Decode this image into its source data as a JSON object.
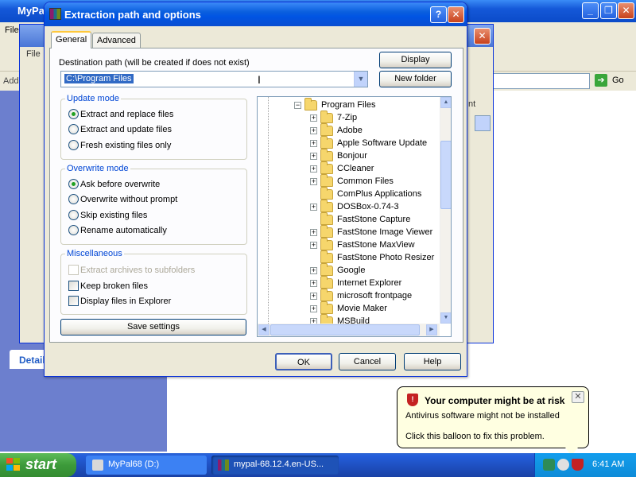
{
  "background": {
    "window_title": "MyPal68 (D:)",
    "menu_file": "File",
    "address_label": "Address",
    "go_label": "Go",
    "details_label": "Details"
  },
  "rar_window": {
    "title": "mypal-68.12.4.en-US...",
    "menu_file": "File",
    "right_label": "nt"
  },
  "dialog": {
    "title": "Extraction path and options",
    "tabs": [
      "General",
      "Advanced"
    ],
    "dest_label": "Destination path (will be created if does not exist)",
    "dest_value": "C:\\Program Files",
    "display_button": "Display",
    "new_folder_button": "New folder",
    "update_mode": {
      "title": "Update mode",
      "options": [
        "Extract and replace files",
        "Extract and update files",
        "Fresh existing files only"
      ],
      "selected": 0
    },
    "overwrite_mode": {
      "title": "Overwrite mode",
      "options": [
        "Ask before overwrite",
        "Overwrite without prompt",
        "Skip existing files",
        "Rename automatically"
      ],
      "selected": 0
    },
    "misc": {
      "title": "Miscellaneous",
      "options": [
        {
          "label": "Extract archives to subfolders",
          "checked": false,
          "disabled": true
        },
        {
          "label": "Keep broken files",
          "checked": false,
          "disabled": false
        },
        {
          "label": "Display files in Explorer",
          "checked": false,
          "disabled": false
        }
      ]
    },
    "save_button": "Save settings",
    "tree": {
      "root": "Program Files",
      "items": [
        {
          "name": "7-Zip",
          "expandable": true
        },
        {
          "name": "Adobe",
          "expandable": true
        },
        {
          "name": "Apple Software Update",
          "expandable": true
        },
        {
          "name": "Bonjour",
          "expandable": true
        },
        {
          "name": "CCleaner",
          "expandable": true
        },
        {
          "name": "Common Files",
          "expandable": true
        },
        {
          "name": "ComPlus Applications",
          "expandable": false
        },
        {
          "name": "DOSBox-0.74-3",
          "expandable": true
        },
        {
          "name": "FastStone Capture",
          "expandable": false
        },
        {
          "name": "FastStone Image Viewer",
          "expandable": true
        },
        {
          "name": "FastStone MaxView",
          "expandable": true
        },
        {
          "name": "FastStone Photo Resizer",
          "expandable": false
        },
        {
          "name": "Google",
          "expandable": true
        },
        {
          "name": "Internet Explorer",
          "expandable": true
        },
        {
          "name": "microsoft frontpage",
          "expandable": true
        },
        {
          "name": "Movie Maker",
          "expandable": true
        },
        {
          "name": "MSBuild",
          "expandable": true
        }
      ]
    },
    "ok_button": "OK",
    "cancel_button": "Cancel",
    "help_button": "Help"
  },
  "balloon": {
    "title": "Your computer might be at risk",
    "line1": "Antivirus software might not be installed",
    "line2": "Click this balloon to fix this problem."
  },
  "taskbar": {
    "start": "start",
    "tasks": [
      "MyPal68 (D:)",
      "mypal-68.12.4.en-US..."
    ],
    "clock": "6:41 AM"
  },
  "colors": {
    "title_blue": "#0054e3",
    "group_title": "#0046d5",
    "balloon_bg": "#ffffe1",
    "start_green": "#3c9a3a"
  }
}
